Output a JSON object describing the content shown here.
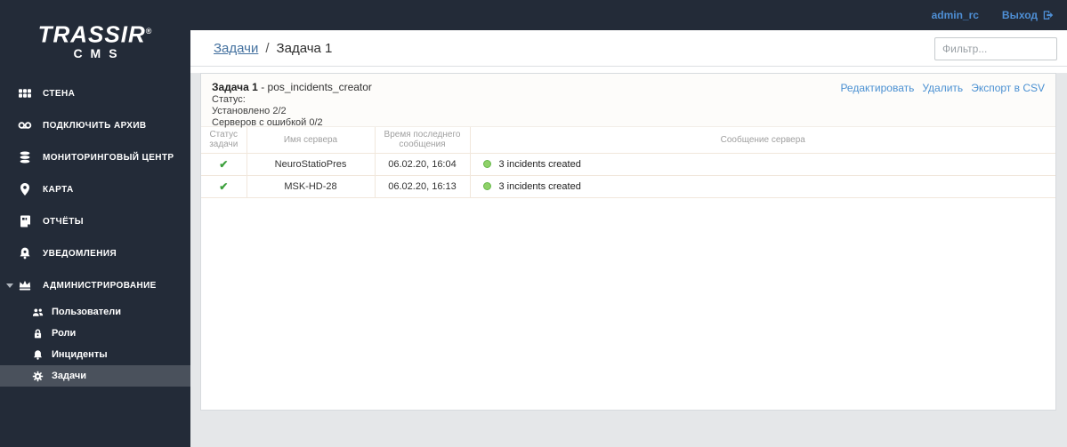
{
  "topbar": {
    "username": "admin_rc",
    "logout_label": "Выход"
  },
  "sidebar": {
    "logo": {
      "line1": "TRASSIR",
      "reg": "®",
      "line2": "CMS"
    },
    "items": [
      {
        "label": "СТЕНА",
        "icon": "wall-icon"
      },
      {
        "label": "ПОДКЛЮЧИТЬ АРХИВ",
        "icon": "archive-icon"
      },
      {
        "label": "МОНИТОРИНГОВЫЙ ЦЕНТР",
        "icon": "monitoring-icon"
      },
      {
        "label": "КАРТА",
        "icon": "map-icon"
      },
      {
        "label": "ОТЧЁТЫ",
        "icon": "reports-icon"
      },
      {
        "label": "УВЕДОМЛЕНИЯ",
        "icon": "notifications-icon"
      },
      {
        "label": "АДМИНИСТРИРОВАНИЕ",
        "icon": "admin-crown-icon",
        "expanded": true
      }
    ],
    "subitems": [
      {
        "label": "Пользователи",
        "icon": "users-icon",
        "selected": false
      },
      {
        "label": "Роли",
        "icon": "lock-icon",
        "selected": false
      },
      {
        "label": "Инциденты",
        "icon": "bell-icon",
        "selected": false
      },
      {
        "label": "Задачи",
        "icon": "gear-icon",
        "selected": true
      }
    ]
  },
  "breadcrumb": {
    "parent": "Задачи",
    "separator": "/",
    "current": "Задача 1"
  },
  "filter": {
    "placeholder": "Фильтр..."
  },
  "task": {
    "title": "Задача 1",
    "subtitle": "- pos_incidents_creator",
    "status_label": "Статус:",
    "installed": "Установлено 2/2",
    "errors": "Серверов с ошибкой 0/2",
    "actions": {
      "edit": "Редактировать",
      "delete": "Удалить",
      "export": "Экспорт в CSV"
    }
  },
  "table": {
    "headers": [
      "Статус задачи",
      "Имя сервера",
      "Время последнего сообщения",
      "Сообщение сервера"
    ],
    "rows": [
      {
        "status_icon": "✔",
        "server": "NeuroStatioPres",
        "time": "06.02.20, 16:04",
        "message": "3 incidents created"
      },
      {
        "status_icon": "✔",
        "server": "MSK-HD-28",
        "time": "06.02.20, 16:13",
        "message": "3 incidents created"
      }
    ]
  },
  "colors": {
    "sidebar_dark": "#232b38",
    "selected_item_gray": "#4a515c",
    "accent_blue": "#4a90d2",
    "topbar_link_blue": "#4e8fd5",
    "breadcrumb_link_blue": "#44719f",
    "success_check_green": "#3da03d",
    "status_dot_green": "#8fd169",
    "table_border_peach": "#f1e7dc",
    "page_bg_gray": "#e5e7e9"
  }
}
